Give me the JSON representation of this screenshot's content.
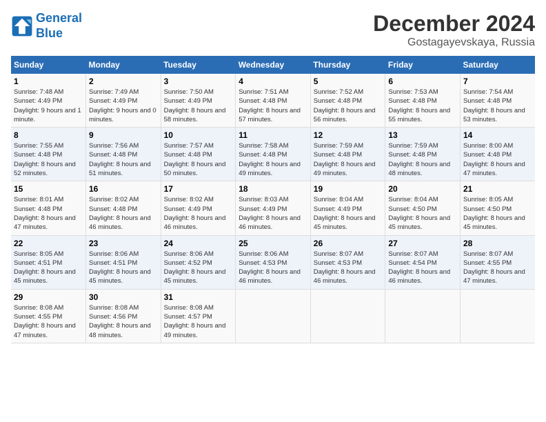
{
  "header": {
    "logo_line1": "General",
    "logo_line2": "Blue",
    "main_title": "December 2024",
    "subtitle": "Gostagayevskaya, Russia"
  },
  "days_of_week": [
    "Sunday",
    "Monday",
    "Tuesday",
    "Wednesday",
    "Thursday",
    "Friday",
    "Saturday"
  ],
  "weeks": [
    [
      {
        "day": "1",
        "sunrise": "Sunrise: 7:48 AM",
        "sunset": "Sunset: 4:49 PM",
        "daylight": "Daylight: 9 hours and 1 minute."
      },
      {
        "day": "2",
        "sunrise": "Sunrise: 7:49 AM",
        "sunset": "Sunset: 4:49 PM",
        "daylight": "Daylight: 9 hours and 0 minutes."
      },
      {
        "day": "3",
        "sunrise": "Sunrise: 7:50 AM",
        "sunset": "Sunset: 4:49 PM",
        "daylight": "Daylight: 8 hours and 58 minutes."
      },
      {
        "day": "4",
        "sunrise": "Sunrise: 7:51 AM",
        "sunset": "Sunset: 4:48 PM",
        "daylight": "Daylight: 8 hours and 57 minutes."
      },
      {
        "day": "5",
        "sunrise": "Sunrise: 7:52 AM",
        "sunset": "Sunset: 4:48 PM",
        "daylight": "Daylight: 8 hours and 56 minutes."
      },
      {
        "day": "6",
        "sunrise": "Sunrise: 7:53 AM",
        "sunset": "Sunset: 4:48 PM",
        "daylight": "Daylight: 8 hours and 55 minutes."
      },
      {
        "day": "7",
        "sunrise": "Sunrise: 7:54 AM",
        "sunset": "Sunset: 4:48 PM",
        "daylight": "Daylight: 8 hours and 53 minutes."
      }
    ],
    [
      {
        "day": "8",
        "sunrise": "Sunrise: 7:55 AM",
        "sunset": "Sunset: 4:48 PM",
        "daylight": "Daylight: 8 hours and 52 minutes."
      },
      {
        "day": "9",
        "sunrise": "Sunrise: 7:56 AM",
        "sunset": "Sunset: 4:48 PM",
        "daylight": "Daylight: 8 hours and 51 minutes."
      },
      {
        "day": "10",
        "sunrise": "Sunrise: 7:57 AM",
        "sunset": "Sunset: 4:48 PM",
        "daylight": "Daylight: 8 hours and 50 minutes."
      },
      {
        "day": "11",
        "sunrise": "Sunrise: 7:58 AM",
        "sunset": "Sunset: 4:48 PM",
        "daylight": "Daylight: 8 hours and 49 minutes."
      },
      {
        "day": "12",
        "sunrise": "Sunrise: 7:59 AM",
        "sunset": "Sunset: 4:48 PM",
        "daylight": "Daylight: 8 hours and 49 minutes."
      },
      {
        "day": "13",
        "sunrise": "Sunrise: 7:59 AM",
        "sunset": "Sunset: 4:48 PM",
        "daylight": "Daylight: 8 hours and 48 minutes."
      },
      {
        "day": "14",
        "sunrise": "Sunrise: 8:00 AM",
        "sunset": "Sunset: 4:48 PM",
        "daylight": "Daylight: 8 hours and 47 minutes."
      }
    ],
    [
      {
        "day": "15",
        "sunrise": "Sunrise: 8:01 AM",
        "sunset": "Sunset: 4:48 PM",
        "daylight": "Daylight: 8 hours and 47 minutes."
      },
      {
        "day": "16",
        "sunrise": "Sunrise: 8:02 AM",
        "sunset": "Sunset: 4:48 PM",
        "daylight": "Daylight: 8 hours and 46 minutes."
      },
      {
        "day": "17",
        "sunrise": "Sunrise: 8:02 AM",
        "sunset": "Sunset: 4:49 PM",
        "daylight": "Daylight: 8 hours and 46 minutes."
      },
      {
        "day": "18",
        "sunrise": "Sunrise: 8:03 AM",
        "sunset": "Sunset: 4:49 PM",
        "daylight": "Daylight: 8 hours and 46 minutes."
      },
      {
        "day": "19",
        "sunrise": "Sunrise: 8:04 AM",
        "sunset": "Sunset: 4:49 PM",
        "daylight": "Daylight: 8 hours and 45 minutes."
      },
      {
        "day": "20",
        "sunrise": "Sunrise: 8:04 AM",
        "sunset": "Sunset: 4:50 PM",
        "daylight": "Daylight: 8 hours and 45 minutes."
      },
      {
        "day": "21",
        "sunrise": "Sunrise: 8:05 AM",
        "sunset": "Sunset: 4:50 PM",
        "daylight": "Daylight: 8 hours and 45 minutes."
      }
    ],
    [
      {
        "day": "22",
        "sunrise": "Sunrise: 8:05 AM",
        "sunset": "Sunset: 4:51 PM",
        "daylight": "Daylight: 8 hours and 45 minutes."
      },
      {
        "day": "23",
        "sunrise": "Sunrise: 8:06 AM",
        "sunset": "Sunset: 4:51 PM",
        "daylight": "Daylight: 8 hours and 45 minutes."
      },
      {
        "day": "24",
        "sunrise": "Sunrise: 8:06 AM",
        "sunset": "Sunset: 4:52 PM",
        "daylight": "Daylight: 8 hours and 45 minutes."
      },
      {
        "day": "25",
        "sunrise": "Sunrise: 8:06 AM",
        "sunset": "Sunset: 4:53 PM",
        "daylight": "Daylight: 8 hours and 46 minutes."
      },
      {
        "day": "26",
        "sunrise": "Sunrise: 8:07 AM",
        "sunset": "Sunset: 4:53 PM",
        "daylight": "Daylight: 8 hours and 46 minutes."
      },
      {
        "day": "27",
        "sunrise": "Sunrise: 8:07 AM",
        "sunset": "Sunset: 4:54 PM",
        "daylight": "Daylight: 8 hours and 46 minutes."
      },
      {
        "day": "28",
        "sunrise": "Sunrise: 8:07 AM",
        "sunset": "Sunset: 4:55 PM",
        "daylight": "Daylight: 8 hours and 47 minutes."
      }
    ],
    [
      {
        "day": "29",
        "sunrise": "Sunrise: 8:08 AM",
        "sunset": "Sunset: 4:55 PM",
        "daylight": "Daylight: 8 hours and 47 minutes."
      },
      {
        "day": "30",
        "sunrise": "Sunrise: 8:08 AM",
        "sunset": "Sunset: 4:56 PM",
        "daylight": "Daylight: 8 hours and 48 minutes."
      },
      {
        "day": "31",
        "sunrise": "Sunrise: 8:08 AM",
        "sunset": "Sunset: 4:57 PM",
        "daylight": "Daylight: 8 hours and 49 minutes."
      },
      {
        "day": "",
        "sunrise": "",
        "sunset": "",
        "daylight": ""
      },
      {
        "day": "",
        "sunrise": "",
        "sunset": "",
        "daylight": ""
      },
      {
        "day": "",
        "sunrise": "",
        "sunset": "",
        "daylight": ""
      },
      {
        "day": "",
        "sunrise": "",
        "sunset": "",
        "daylight": ""
      }
    ]
  ]
}
